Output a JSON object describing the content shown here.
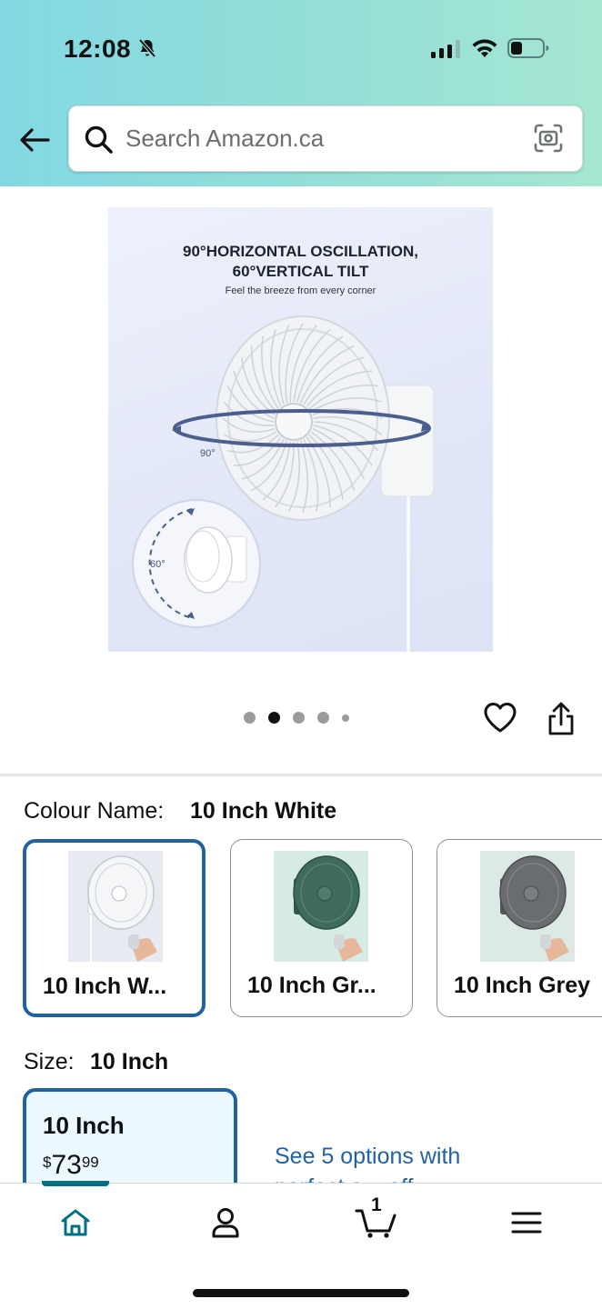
{
  "status_bar": {
    "time": "12:08",
    "icons": [
      "bell-slash-icon",
      "cellular-signal-icon",
      "wifi-icon",
      "battery-icon"
    ]
  },
  "header": {
    "back_icon": "arrow-left-icon",
    "search": {
      "placeholder": "Search Amazon.ca",
      "value": "",
      "icon": "search-icon",
      "lens_icon": "camera-search-icon"
    }
  },
  "product_image": {
    "heading_line1": "90°HORIZONTAL OSCILLATION,",
    "heading_line2": "60°VERTICAL TILT",
    "subheading": "Feel the breeze from every corner",
    "angle_horizontal": "90°",
    "angle_vertical": "60°"
  },
  "carousel": {
    "total": 5,
    "active_index": 1
  },
  "actions": {
    "wishlist_icon": "heart-icon",
    "share_icon": "share-icon"
  },
  "colour": {
    "label": "Colour Name:",
    "value": "10 Inch White",
    "options": [
      {
        "label": "10 Inch W...",
        "selected": true,
        "fan_color": "#f3f4f6"
      },
      {
        "label": "10 Inch Gr...",
        "selected": false,
        "fan_color": "#3e6b5c"
      },
      {
        "label": "10 Inch Grey",
        "selected": false,
        "fan_color": "#6a6d70"
      }
    ]
  },
  "size": {
    "label": "Size:",
    "value": "10 Inch",
    "options": [
      {
        "label": "10 Inch",
        "price_symbol": "$",
        "price_whole": "73",
        "price_fraction": "99"
      }
    ],
    "more_options_line1": "See 5 options with",
    "more_options_line2": "perfect a... off"
  },
  "bottom_nav": {
    "items": [
      {
        "name": "home",
        "icon": "home-icon",
        "active": true
      },
      {
        "name": "account",
        "icon": "user-icon",
        "active": false
      },
      {
        "name": "cart",
        "icon": "cart-icon",
        "active": false,
        "count": "1"
      },
      {
        "name": "menu",
        "icon": "hamburger-menu-icon",
        "active": false
      }
    ]
  },
  "colors": {
    "header_gradient_start": "#82d8e3",
    "header_gradient_end": "#a5e6d2",
    "selected_border": "#2162a1",
    "link": "#2162a1",
    "nav_active": "#007185"
  }
}
